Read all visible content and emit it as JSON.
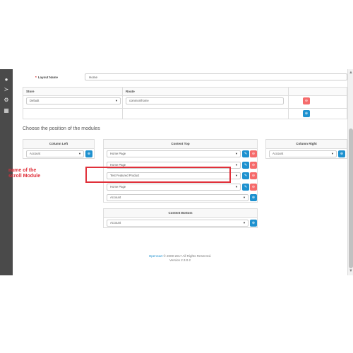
{
  "layout": {
    "name_label": "Layout Name",
    "name_value": "Home"
  },
  "route_table": {
    "headers": {
      "store": "Store",
      "route": "Route"
    },
    "row": {
      "store": "Default",
      "route": "common/home"
    }
  },
  "positions_title": "Choose the position of the modules",
  "column_left": {
    "title": "Column Left",
    "select": "Account"
  },
  "content_top": {
    "title": "Content Top",
    "items": [
      "Home Page",
      "Home Page",
      "Test Featured Product",
      "Home Page"
    ],
    "add_select": "Account"
  },
  "column_right": {
    "title": "Column Right",
    "select": "Account"
  },
  "content_bottom": {
    "title": "Content Bottom",
    "select": "Account"
  },
  "annotation": {
    "line1": "name of the",
    "line2": "scroll Module"
  },
  "footer": {
    "brand": "OpenCart",
    "copyright": " © 2009-2017 All Rights Reserved.",
    "version": "Version 2.3.0.2"
  },
  "colors": {
    "sidebar": "#4a4a4a",
    "primary": "#1e91cf",
    "danger": "#f56b6b",
    "annotation": "#e0303a"
  }
}
